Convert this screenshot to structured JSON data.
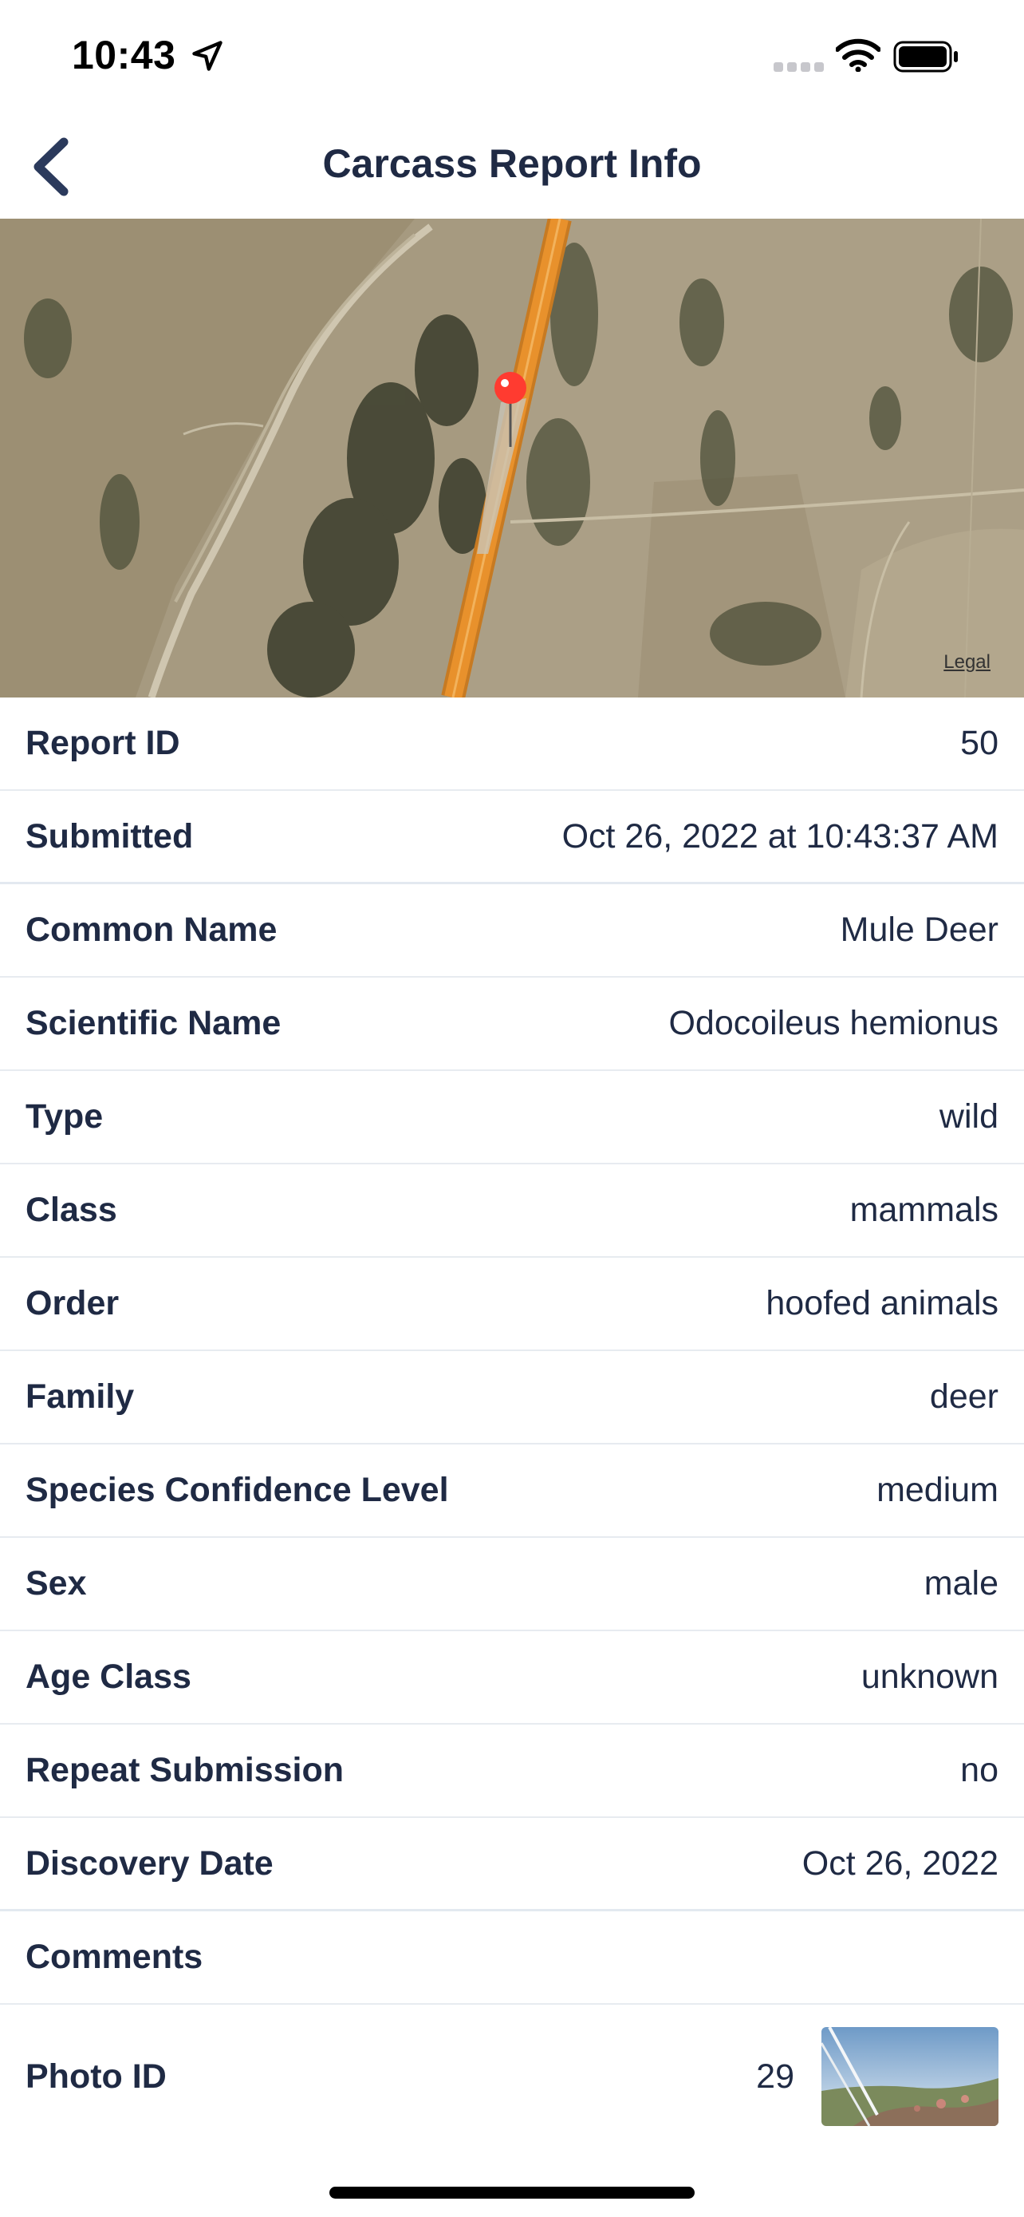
{
  "status_bar": {
    "time": "10:43",
    "icons": [
      "location-arrow-icon",
      "cellular-signal-icon",
      "wifi-icon",
      "battery-icon"
    ]
  },
  "nav": {
    "title": "Carcass Report Info",
    "back_icon": "chevron-left-icon",
    "accent_color": "#2b3a5c"
  },
  "map": {
    "legal_label": "Legal",
    "pin_color": "#ff3b30",
    "road_color": "#e8912c"
  },
  "details": {
    "report_id": {
      "label": "Report ID",
      "value": "50"
    },
    "submitted": {
      "label": "Submitted",
      "value": "Oct 26, 2022 at 10:43:37 AM"
    },
    "common_name": {
      "label": "Common Name",
      "value": "Mule Deer"
    },
    "scientific_name": {
      "label": "Scientific Name",
      "value": "Odocoileus hemionus"
    },
    "type": {
      "label": "Type",
      "value": "wild"
    },
    "class": {
      "label": "Class",
      "value": "mammals"
    },
    "order": {
      "label": "Order",
      "value": "hoofed animals"
    },
    "family": {
      "label": "Family",
      "value": "deer"
    },
    "species_confidence": {
      "label": "Species Confidence Level",
      "value": "medium"
    },
    "sex": {
      "label": "Sex",
      "value": "male"
    },
    "age_class": {
      "label": "Age Class",
      "value": "unknown"
    },
    "repeat_submission": {
      "label": "Repeat Submission",
      "value": "no"
    },
    "discovery_date": {
      "label": "Discovery Date",
      "value": "Oct 26, 2022"
    },
    "comments": {
      "label": "Comments",
      "value": ""
    },
    "photo_id": {
      "label": "Photo ID",
      "value": "29"
    }
  }
}
